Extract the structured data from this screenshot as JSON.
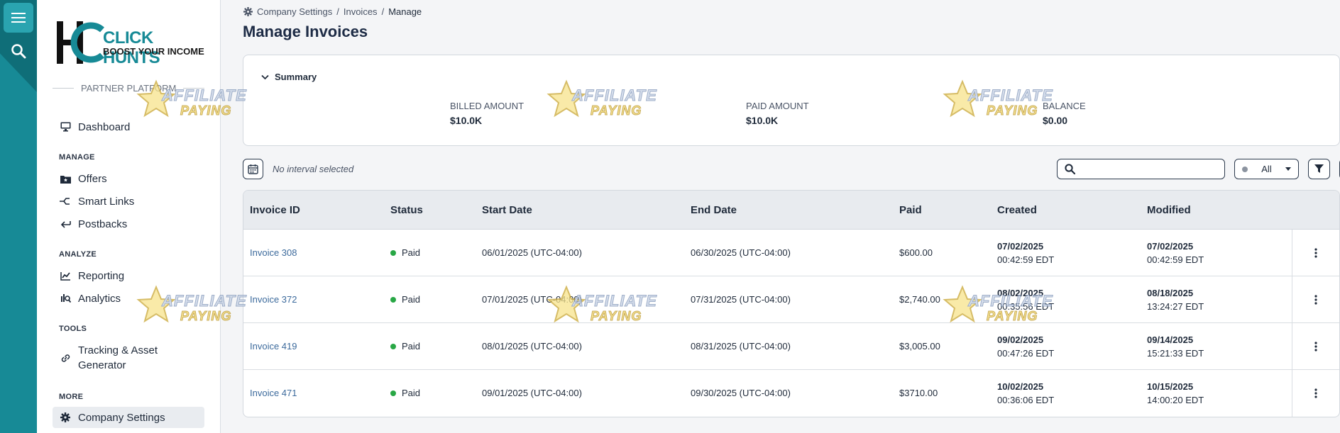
{
  "rail": {
    "menu_icon": "hamburger-icon",
    "search_icon": "search-icon"
  },
  "logo": {
    "word1": "CLICK HUNTS",
    "word2": "BOOST YOUR INCOME"
  },
  "sidebar": {
    "platform_label": "PARTNER PLATFORM",
    "dashboard": "Dashboard",
    "sections": {
      "manage": "MANAGE",
      "analyze": "ANALYZE",
      "tools": "TOOLS",
      "more": "MORE"
    },
    "items": {
      "offers": "Offers",
      "smart_links": "Smart Links",
      "postbacks": "Postbacks",
      "reporting": "Reporting",
      "analytics": "Analytics",
      "tracking_line1": "Tracking & Asset",
      "tracking_line2": "Generator",
      "company_settings": "Company Settings"
    }
  },
  "breadcrumb": {
    "item1": "Company Settings",
    "sep": "/",
    "item2": "Invoices",
    "item3": "Manage"
  },
  "page_title": "Manage Invoices",
  "summary": {
    "toggle_label": "Summary",
    "billed_label": "BILLED AMOUNT",
    "billed_value": "$10.0K",
    "paid_label": "PAID AMOUNT",
    "paid_value": "$10.0K",
    "balance_label": "BALANCE",
    "balance_value": "$0.00"
  },
  "toolbar": {
    "interval_text": "No interval selected",
    "search_placeholder": "",
    "status_filter": "All"
  },
  "table": {
    "headers": {
      "invoice_id": "Invoice ID",
      "status": "Status",
      "start_date": "Start Date",
      "end_date": "End Date",
      "paid": "Paid",
      "created": "Created",
      "modified": "Modified"
    },
    "rows": [
      {
        "invoice": "Invoice 308",
        "status": "Paid",
        "start": "06/01/2025 (UTC-04:00)",
        "end": "06/30/2025 (UTC-04:00)",
        "paid": "$600.00",
        "created_date": "07/02/2025",
        "created_time": "00:42:59 EDT",
        "modified_date": "07/02/2025",
        "modified_time": "00:42:59 EDT"
      },
      {
        "invoice": "Invoice 372",
        "status": "Paid",
        "start": "07/01/2025 (UTC-04:00)",
        "end": "07/31/2025 (UTC-04:00)",
        "paid": "$2,740.00",
        "created_date": "08/02/2025",
        "created_time": "00:35:56 EDT",
        "modified_date": "08/18/2025",
        "modified_time": "13:24:27 EDT"
      },
      {
        "invoice": "Invoice 419",
        "status": "Paid",
        "start": "08/01/2025 (UTC-04:00)",
        "end": "08/31/2025 (UTC-04:00)",
        "paid": "$3,005.00",
        "created_date": "09/02/2025",
        "created_time": "00:47:26 EDT",
        "modified_date": "09/14/2025",
        "modified_time": "15:21:33 EDT"
      },
      {
        "invoice": "Invoice 471",
        "status": "Paid",
        "start": "09/01/2025 (UTC-04:00)",
        "end": "09/30/2025 (UTC-04:00)",
        "paid": "$3710.00",
        "created_date": "10/02/2025",
        "created_time": "00:36:06 EDT",
        "modified_date": "10/15/2025",
        "modified_time": "14:00:20 EDT"
      }
    ]
  },
  "watermark": {
    "line1": "AFFILIATE",
    "line2": "PAYING"
  },
  "colors": {
    "brand_teal": "#178a96",
    "link_blue": "#3c6a9c",
    "status_green": "#28a745"
  }
}
